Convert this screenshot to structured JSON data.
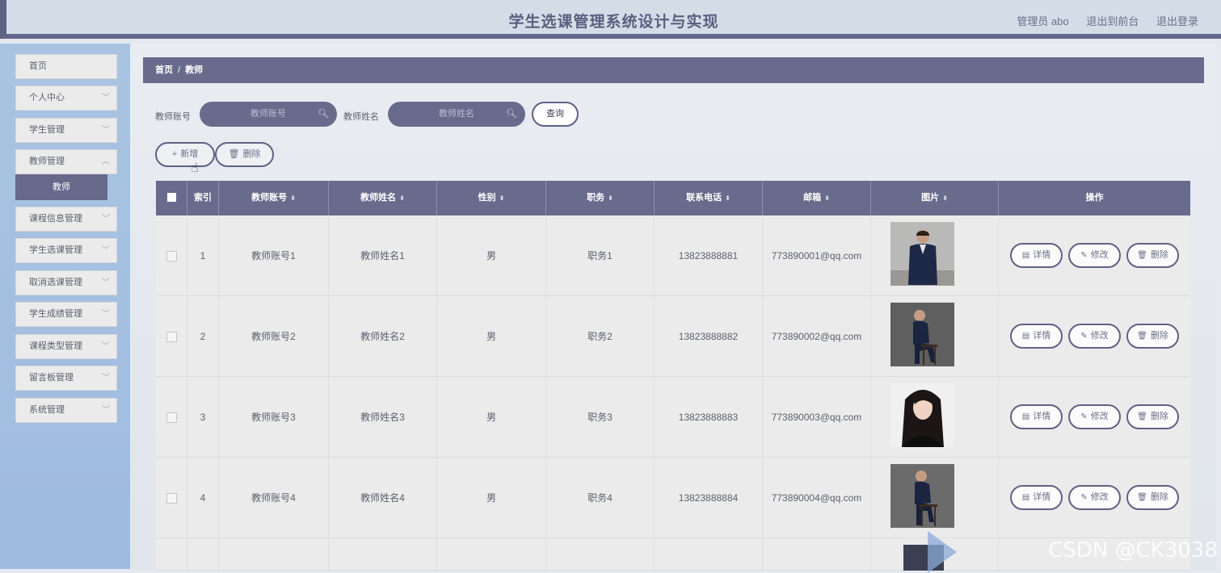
{
  "header": {
    "title": "学生选课管理系统设计与实现",
    "user": "管理员 abo",
    "front_link": "退出到前台",
    "logout_link": "退出登录"
  },
  "sidebar": {
    "items": [
      {
        "label": "首页"
      },
      {
        "label": "个人中心"
      },
      {
        "label": "学生管理"
      },
      {
        "label": "教师管理"
      },
      {
        "label": "课程信息管理"
      },
      {
        "label": "学生选课管理"
      },
      {
        "label": "取消选课管理"
      },
      {
        "label": "学生成绩管理"
      },
      {
        "label": "课程类型管理"
      },
      {
        "label": "留言板管理"
      },
      {
        "label": "系统管理"
      }
    ],
    "submenu_active": "教师"
  },
  "breadcrumb": {
    "home": "首页",
    "separator": "/",
    "current": "教师"
  },
  "search": {
    "account_label": "教师账号",
    "account_placeholder": "教师账号",
    "name_label": "教师姓名",
    "name_placeholder": "教师姓名",
    "query_button": "查询"
  },
  "toolbar": {
    "add_label": "新增",
    "delete_label": "删除"
  },
  "table": {
    "headers": [
      "索引",
      "教师账号",
      "教师姓名",
      "性别",
      "职务",
      "联系电话",
      "邮箱",
      "图片",
      "操作"
    ],
    "rows": [
      {
        "index": "1",
        "account": "教师账号1",
        "name": "教师姓名1",
        "gender": "男",
        "post": "职务1",
        "phone": "13823888881",
        "email": "773890001@qq.com"
      },
      {
        "index": "2",
        "account": "教师账号2",
        "name": "教师姓名2",
        "gender": "男",
        "post": "职务2",
        "phone": "13823888882",
        "email": "773890002@qq.com"
      },
      {
        "index": "3",
        "account": "教师账号3",
        "name": "教师姓名3",
        "gender": "男",
        "post": "职务3",
        "phone": "13823888883",
        "email": "773890003@qq.com"
      },
      {
        "index": "4",
        "account": "教师账号4",
        "name": "教师姓名4",
        "gender": "男",
        "post": "职务4",
        "phone": "13823888884",
        "email": "773890004@qq.com"
      }
    ],
    "row_actions": {
      "detail": "详情",
      "edit": "修改",
      "delete": "删除"
    }
  },
  "watermark": "CSDN @CK3038",
  "colors": {
    "accent": "#696b8d",
    "header_bg": "#d3dde7",
    "sidebar_bg": "#a9c4e1"
  }
}
